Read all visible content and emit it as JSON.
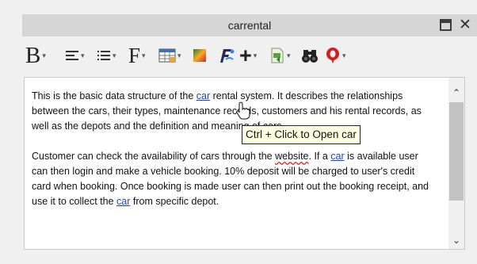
{
  "window": {
    "title": "carrental"
  },
  "toolbar": {
    "bold_glyph": "B",
    "font_glyph": "F",
    "plus_glyph": "+",
    "caret": "▾",
    "items": [
      {
        "name": "bold-icon",
        "has_dropdown": true
      },
      {
        "name": "align-icon",
        "has_dropdown": true
      },
      {
        "name": "list-icon",
        "has_dropdown": true
      },
      {
        "name": "font-icon",
        "has_dropdown": true
      },
      {
        "name": "table-icon",
        "has_dropdown": true
      },
      {
        "name": "color-picker-icon",
        "has_dropdown": false
      },
      {
        "name": "clear-format-icon",
        "has_dropdown": false
      },
      {
        "name": "insert-icon",
        "has_dropdown": true
      },
      {
        "name": "document-icon",
        "has_dropdown": true
      },
      {
        "name": "find-binoculars-icon",
        "has_dropdown": false
      },
      {
        "name": "spellcheck-icon",
        "has_dropdown": true
      }
    ]
  },
  "editor": {
    "p1": {
      "t1": "This is the basic data structure of the ",
      "link1": "car",
      "t2": " rental system. It describes the relationships between the cars, their types, maintenance records, customers and his rental records, as well as the depots and the definition and meaning of cars."
    },
    "p2": {
      "t1": "Customer can check the availability of cars through the ",
      "spell1": "website",
      "t2": ". If a ",
      "link1": "car",
      "t3": " is available user can then login and make a vehicle booking. 10% deposit will be charged to user's credit card when booking. Once booking is made user can then print out the booking receipt, and use it to collect the ",
      "link2": "car",
      "t4": " from specific depot."
    }
  },
  "scrollbar": {
    "up_glyph": "⌃",
    "down_glyph": "⌄"
  },
  "tooltip": {
    "text": "Ctrl + Click to Open car"
  },
  "colors": {
    "link": "#1a44d6",
    "spellcheck": "#e02020",
    "tooltip_bg": "#ffffe1",
    "titlebar_bg": "#d6d6d6"
  }
}
